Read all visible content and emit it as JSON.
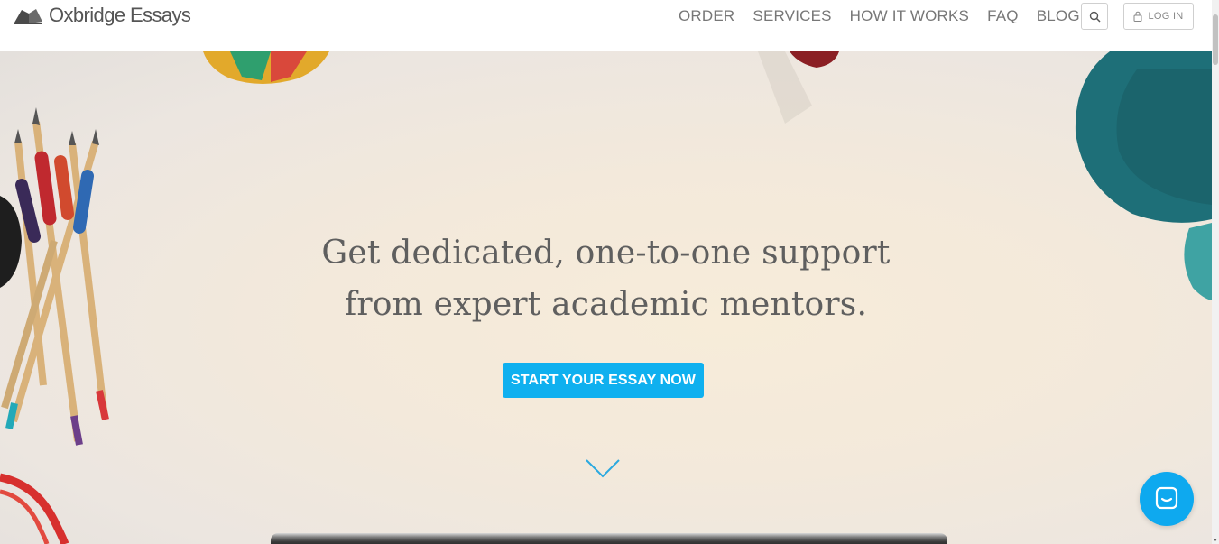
{
  "header": {
    "logo_text": "Oxbridge Essays",
    "nav": [
      "ORDER",
      "SERVICES",
      "HOW IT WORKS",
      "FAQ",
      "BLOG"
    ],
    "search_icon": "search-icon",
    "login_label": "LOG IN",
    "login_icon": "lock-icon"
  },
  "hero": {
    "headline_line1": "Get dedicated, one-to-one support",
    "headline_line2": "from expert academic mentors.",
    "cta_label": "START YOUR ESSAY NOW",
    "scroll_icon": "chevron-down-icon"
  },
  "chat": {
    "icon": "chat-icon"
  },
  "colors": {
    "accent": "#0fb0ef",
    "nav_text": "#777777",
    "headline_text": "#5f5f5f",
    "chat": "#0ea9ef"
  }
}
